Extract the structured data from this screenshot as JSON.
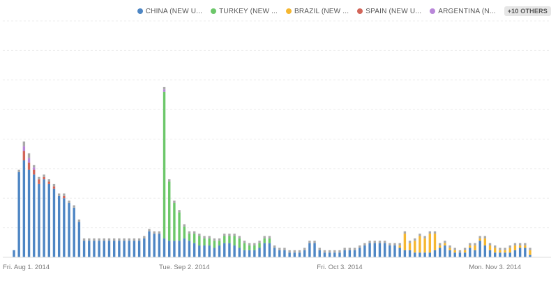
{
  "legend": {
    "items": [
      {
        "label": "CHINA (NEW U...",
        "color": "#4e86c4"
      },
      {
        "label": "TURKEY (NEW ...",
        "color": "#6cc76a"
      },
      {
        "label": "BRAZIL (NEW ...",
        "color": "#f5b731"
      },
      {
        "label": "SPAIN (NEW U...",
        "color": "#d2665a"
      },
      {
        "label": "ARGENTINA (N...",
        "color": "#b987d9"
      }
    ],
    "more_label": "+10 OTHERS"
  },
  "chart_data": {
    "type": "bar",
    "stacked": true,
    "grid": true,
    "legend_position": "top-right",
    "ylim": [
      0,
      100
    ],
    "x_tick_labels": [
      "Fri. Aug 1. 2014",
      "Tue. Sep 2. 2014",
      "Fri. Oct 3. 2014",
      "Mon. Nov 3. 2014"
    ],
    "x_tick_index": [
      2,
      34,
      65,
      96
    ],
    "others_color": "#aaaaaa",
    "series": [
      {
        "name": "CHINA (NEW U...",
        "color": "#4e86c4",
        "values": [
          3,
          36,
          41,
          37,
          35,
          31,
          33,
          31,
          29,
          26,
          25,
          23,
          21,
          15,
          7,
          7,
          7,
          7,
          7,
          7,
          7,
          7,
          7,
          7,
          7,
          7,
          8,
          11,
          10,
          10,
          8,
          7,
          7,
          7,
          8,
          7,
          6,
          5,
          5,
          5,
          4,
          5,
          6,
          6,
          5,
          4,
          3,
          3,
          3,
          4,
          6,
          6,
          4,
          3,
          3,
          2,
          2,
          2,
          3,
          6,
          6,
          3,
          2,
          2,
          2,
          2,
          3,
          3,
          3,
          4,
          5,
          6,
          6,
          6,
          6,
          5,
          5,
          4,
          3,
          3,
          2,
          2,
          2,
          2,
          3,
          4,
          5,
          3,
          2,
          2,
          2,
          4,
          3,
          7,
          5,
          3,
          2,
          2,
          2,
          2,
          3,
          4,
          4,
          1
        ]
      },
      {
        "name": "TURKEY (NEW ...",
        "color": "#6cc76a",
        "values": [
          0,
          0,
          0,
          0,
          0,
          0,
          0,
          0,
          0,
          0,
          0,
          0,
          0,
          0,
          0,
          0,
          0,
          0,
          0,
          0,
          0,
          0,
          0,
          0,
          0,
          0,
          0,
          0,
          0,
          0,
          62,
          25,
          16,
          12,
          5,
          3,
          4,
          4,
          3,
          3,
          3,
          2,
          3,
          3,
          4,
          4,
          3,
          2,
          2,
          2,
          2,
          2,
          0,
          0,
          0,
          0,
          0,
          0,
          0,
          0,
          0,
          0,
          0,
          0,
          0,
          0,
          0,
          0,
          0,
          0,
          0,
          0,
          0,
          0,
          0,
          0,
          0,
          0,
          0,
          0,
          0,
          0,
          0,
          0,
          0,
          0,
          0,
          0,
          0,
          0,
          0,
          0,
          0,
          0,
          0,
          0,
          0,
          0,
          0,
          0,
          0,
          0,
          0,
          0
        ]
      },
      {
        "name": "BRAZIL (NEW ...",
        "color": "#f5b731",
        "values": [
          0,
          0,
          0,
          0,
          0,
          0,
          0,
          0,
          0,
          0,
          0,
          0,
          0,
          0,
          0,
          0,
          0,
          0,
          0,
          0,
          0,
          0,
          0,
          0,
          0,
          0,
          0,
          0,
          0,
          0,
          0,
          0,
          0,
          0,
          0,
          0,
          0,
          0,
          0,
          0,
          0,
          0,
          0,
          0,
          0,
          0,
          0,
          0,
          0,
          0,
          0,
          0,
          0,
          0,
          0,
          0,
          0,
          0,
          0,
          0,
          0,
          0,
          0,
          0,
          0,
          0,
          0,
          0,
          0,
          0,
          0,
          0,
          0,
          0,
          0,
          0,
          0,
          1,
          7,
          3,
          5,
          7,
          6,
          8,
          7,
          1,
          1,
          1,
          1,
          0,
          1,
          1,
          2,
          1,
          3,
          2,
          2,
          1,
          1,
          2,
          2,
          1,
          1,
          2
        ]
      },
      {
        "name": "SPAIN (NEW U...",
        "color": "#d2665a",
        "values": [
          0,
          0,
          4,
          3,
          2,
          2,
          1,
          1,
          1,
          0,
          1,
          0,
          0,
          0,
          0,
          0,
          0,
          0,
          0,
          0,
          0,
          0,
          0,
          0,
          0,
          0,
          0,
          0,
          0,
          0,
          0,
          0,
          0,
          0,
          0,
          0,
          0,
          0,
          0,
          0,
          0,
          0,
          0,
          0,
          0,
          0,
          0,
          0,
          0,
          0,
          0,
          0,
          0,
          0,
          0,
          0,
          0,
          0,
          0,
          0,
          0,
          0,
          0,
          0,
          0,
          0,
          0,
          0,
          0,
          0,
          0,
          0,
          0,
          0,
          0,
          0,
          0,
          0,
          0,
          0,
          0,
          0,
          0,
          0,
          0,
          0,
          0,
          0,
          0,
          0,
          0,
          0,
          0,
          0,
          0,
          0,
          0,
          0,
          0,
          0,
          0,
          0,
          0,
          0
        ]
      },
      {
        "name": "ARGENTINA (N...",
        "color": "#b987d9",
        "values": [
          0,
          0,
          2,
          2,
          1,
          0,
          0,
          0,
          0,
          0,
          0,
          0,
          0,
          0,
          0,
          0,
          0,
          0,
          0,
          0,
          0,
          0,
          0,
          0,
          0,
          0,
          0,
          0,
          0,
          0,
          1,
          0,
          0,
          0,
          0,
          0,
          0,
          0,
          0,
          0,
          0,
          0,
          0,
          0,
          0,
          0,
          0,
          0,
          0,
          0,
          0,
          0,
          0,
          0,
          0,
          0,
          0,
          0,
          0,
          0,
          0,
          0,
          0,
          0,
          0,
          0,
          0,
          0,
          0,
          0,
          0,
          0,
          0,
          0,
          0,
          0,
          0,
          0,
          0,
          0,
          0,
          0,
          0,
          0,
          0,
          0,
          0,
          0,
          0,
          0,
          0,
          0,
          0,
          0,
          0,
          0,
          0,
          0,
          0,
          0,
          0,
          0,
          0,
          0
        ]
      }
    ],
    "others_values": [
      0,
      1,
      2,
      2,
      1,
      1,
      1,
      1,
      1,
      1,
      1,
      1,
      1,
      1,
      1,
      1,
      1,
      1,
      1,
      1,
      1,
      1,
      1,
      1,
      1,
      1,
      1,
      1,
      1,
      1,
      1,
      1,
      1,
      1,
      1,
      1,
      1,
      1,
      1,
      1,
      1,
      1,
      1,
      1,
      1,
      1,
      1,
      1,
      1,
      1,
      1,
      1,
      1,
      1,
      1,
      1,
      1,
      1,
      1,
      1,
      1,
      1,
      1,
      1,
      1,
      1,
      1,
      1,
      1,
      1,
      1,
      1,
      1,
      1,
      1,
      1,
      1,
      1,
      1,
      1,
      1,
      1,
      1,
      1,
      1,
      1,
      1,
      1,
      1,
      1,
      1,
      1,
      1,
      1,
      1,
      1,
      1,
      1,
      1,
      1,
      1,
      1,
      1,
      1
    ]
  }
}
